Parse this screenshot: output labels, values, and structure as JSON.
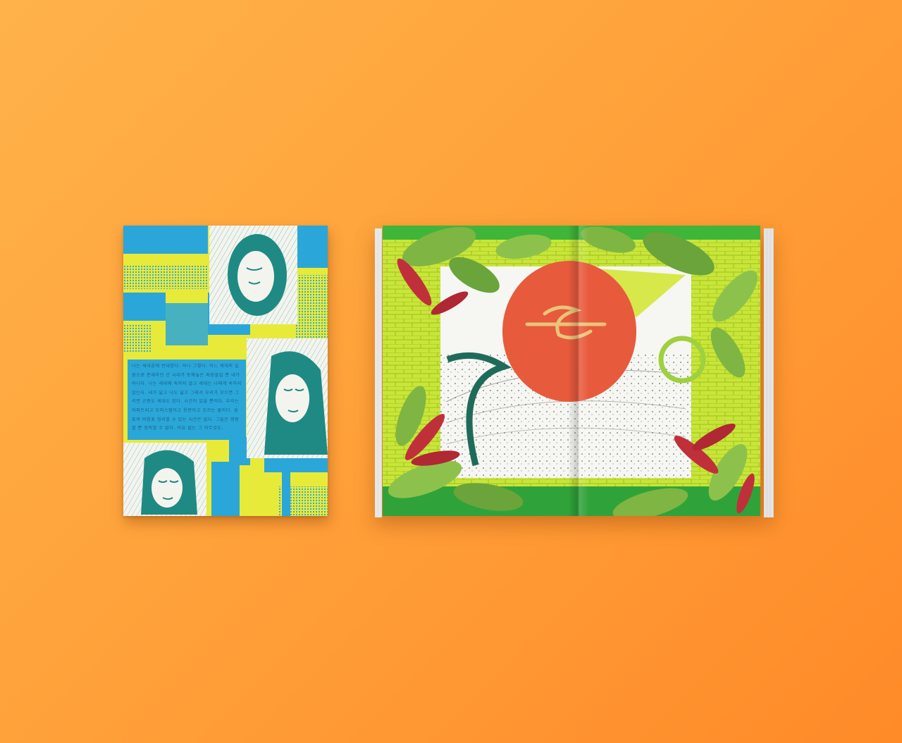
{
  "scene": {
    "background_color": "#ffa43c",
    "description_items": [
      "closed-book-cover",
      "open-book-spread"
    ]
  },
  "closed_book": {
    "palette": {
      "yellow": "#e8ea3a",
      "blue": "#2aa7d8",
      "teal": "#1f8a84",
      "white": "#f4f4ee"
    },
    "body_text": "나는 세대론에 반대한다. 아니 그렇다. 어느 세대의 일원으로 존재하던 건 시대가 토해놓은 파장들일 뿐 내가 아니다. 나는 세대에 속하지 않고 세대는 나에게 속하지 않는다. 내가 넓고 나도 넓고 그래서 우리가 모으면 그리면 군중도 세대도 된다. 시간이 있을 뿐이다. 우리는 아파트되고 오피스텔이고 옷판이고 흐르는 물이다. 쉼표와 마침표 정리할 수 있는 시간은 없다. 그들은 영원할 뿐 정의할 수 없다. 이유 없는 그 아무것도."
  },
  "open_book": {
    "palette": {
      "green": "#3fb53a",
      "lime": "#c8e63a",
      "red": "#e85a3c",
      "leaf": "#7fb542",
      "white": "#f6f6f2",
      "dark_teal": "#1f6b5a"
    }
  }
}
